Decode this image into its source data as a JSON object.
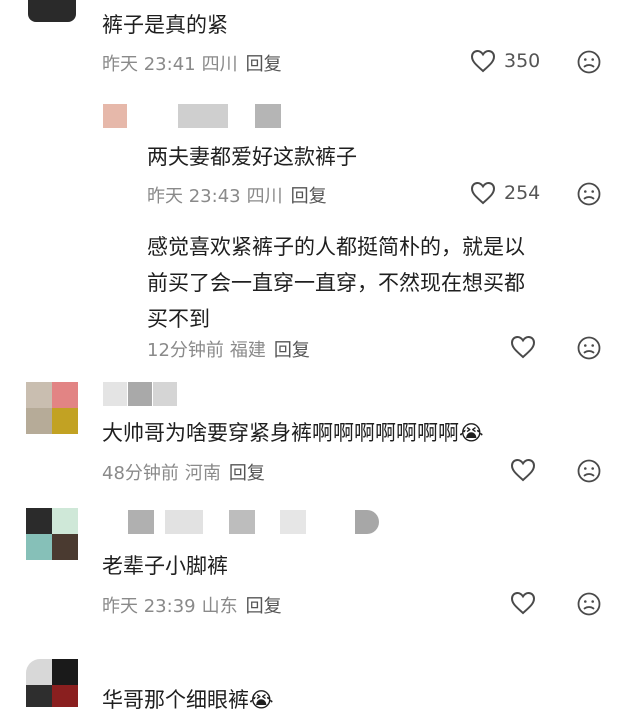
{
  "comments": [
    {
      "id": "c1",
      "text": "裤子是真的紧",
      "time": "昨天 23:41",
      "location": "四川",
      "reply_label": "回复",
      "likes": "350"
    },
    {
      "id": "c2",
      "text": "两夫妻都爱好这款裤子",
      "time": "昨天 23:43",
      "location": "四川",
      "reply_label": "回复",
      "likes": "254"
    },
    {
      "id": "c3",
      "text_lines": [
        "感觉喜欢紧裤子的人都挺简朴的，就是以",
        "前买了会一直穿一直穿，不然现在想买都",
        "买不到"
      ],
      "time": "12分钟前",
      "location": "福建",
      "reply_label": "回复"
    },
    {
      "id": "c4",
      "text": "大帅哥为啥要穿紧身裤啊啊啊啊啊啊啊",
      "emoji": "😭",
      "time": "48分钟前",
      "location": "河南",
      "reply_label": "回复"
    },
    {
      "id": "c5",
      "text": "老辈子小脚裤",
      "time": "昨天 23:39",
      "location": "山东",
      "reply_label": "回复"
    },
    {
      "id": "c6",
      "text": "华哥那个细眼裤",
      "emoji": "😭"
    }
  ],
  "icons": {
    "like": "heart-outline-icon",
    "dislike": "frown-face-icon"
  },
  "colors": {
    "text": "#1f1f1f",
    "meta": "#8a8a8a",
    "icon": "#4a4a4a"
  }
}
